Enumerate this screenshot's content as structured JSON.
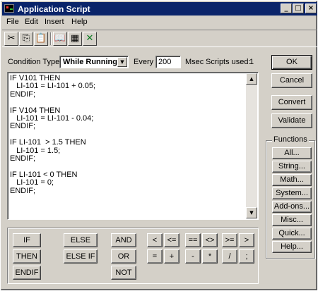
{
  "window": {
    "title": "Application Script",
    "controls": {
      "minimize": "_",
      "maximize": "□",
      "close": "×"
    }
  },
  "menu": [
    "File",
    "Edit",
    "Insert",
    "Help"
  ],
  "toolbar": {
    "icons": [
      "cut-icon",
      "copy-icon",
      "paste-icon",
      "book-icon",
      "spreadsheet-icon",
      "excel-icon"
    ],
    "glyphs": [
      "✂",
      "⎘",
      "📋",
      "📖",
      "▦",
      "✕"
    ]
  },
  "settings": {
    "condition_type_label": "Condition Type:",
    "condition_type_value": "While Running",
    "every_label": "Every",
    "every_value": "200",
    "msec_label": "Msec",
    "scripts_used_label": "Scripts used:",
    "scripts_used_value": "1"
  },
  "script": "IF V101 THEN\n   LI-101 = LI-101 + 0.05;\nENDIF;\n\nIF V104 THEN\n   LI-101 = LI-101 - 0.04;\nENDIF;\n\nIF LI-101  > 1.5 THEN\n   LI-101 = 1.5;\nENDIF;\n\nIF LI-101 < 0 THEN\n   LI-101 = 0;\nENDIF;",
  "actions": {
    "ok": "OK",
    "cancel": "Cancel",
    "convert": "Convert",
    "validate": "Validate"
  },
  "functions": {
    "legend": "Functions",
    "buttons": [
      "All...",
      "String...",
      "Math...",
      "System...",
      "Add-ons...",
      "Misc...",
      "Quick...",
      "Help..."
    ]
  },
  "keypad": {
    "if": "IF",
    "then": "THEN",
    "endif": "ENDIF",
    "else": "ELSE",
    "else_if": "ELSE IF",
    "and": "AND",
    "or": "OR",
    "not": "NOT",
    "lt": "<",
    "le": "<=",
    "eq": "==",
    "ne": "<>",
    "ge": ">=",
    "gt": ">",
    "assign": "=",
    "plus": "+",
    "minus": "-",
    "times": "*",
    "divide": "/",
    "semicolon": ";"
  }
}
